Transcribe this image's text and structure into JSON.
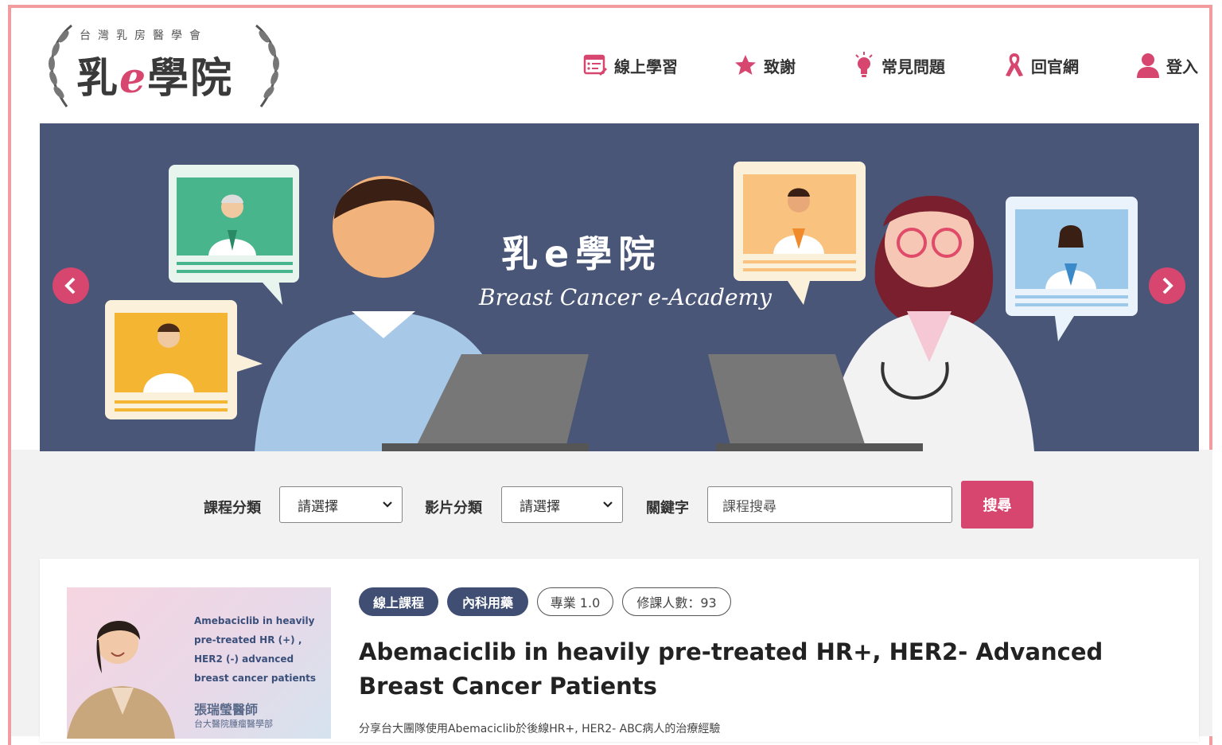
{
  "logo": {
    "society": "台灣乳房醫學會",
    "title_part1": "乳",
    "title_e": "e",
    "title_part2": "學院"
  },
  "nav": {
    "items": [
      {
        "label": "線上學習",
        "icon": "course-icon"
      },
      {
        "label": "致謝",
        "icon": "star-icon"
      },
      {
        "label": "常見問題",
        "icon": "lightbulb-icon"
      },
      {
        "label": "回官網",
        "icon": "ribbon-icon"
      },
      {
        "label": "登入",
        "icon": "user-icon"
      }
    ]
  },
  "banner": {
    "title": "乳e學院",
    "subtitle": "Breast Cancer e-Academy"
  },
  "search": {
    "course_category_label": "課程分類",
    "course_category_value": "請選擇",
    "video_category_label": "影片分類",
    "video_category_value": "請選擇",
    "keyword_label": "關鍵字",
    "keyword_placeholder": "課程搜尋",
    "search_button": "搜尋"
  },
  "course": {
    "tags": [
      "線上課程",
      "內科用藥",
      "專業 1.0",
      "修課人數：93"
    ],
    "title": "Abemaciclib in heavily pre-treated HR+, HER2- Advanced Breast Cancer Patients",
    "description": "分享台大團隊使用Abemaciclib於後線HR+, HER2- ABC病人的治療經驗",
    "thumbnail": {
      "text": "Amebaciclib in heavily pre-treated HR (+) , HER2 (-) advanced breast cancer patients",
      "doctor": "張瑞瑩醫師",
      "dept": "台大醫院腫瘤醫學部"
    }
  },
  "colors": {
    "accent": "#d6466f",
    "banner": "#4a5677",
    "tag": "#3f4e72",
    "frame": "#f19c9f"
  }
}
